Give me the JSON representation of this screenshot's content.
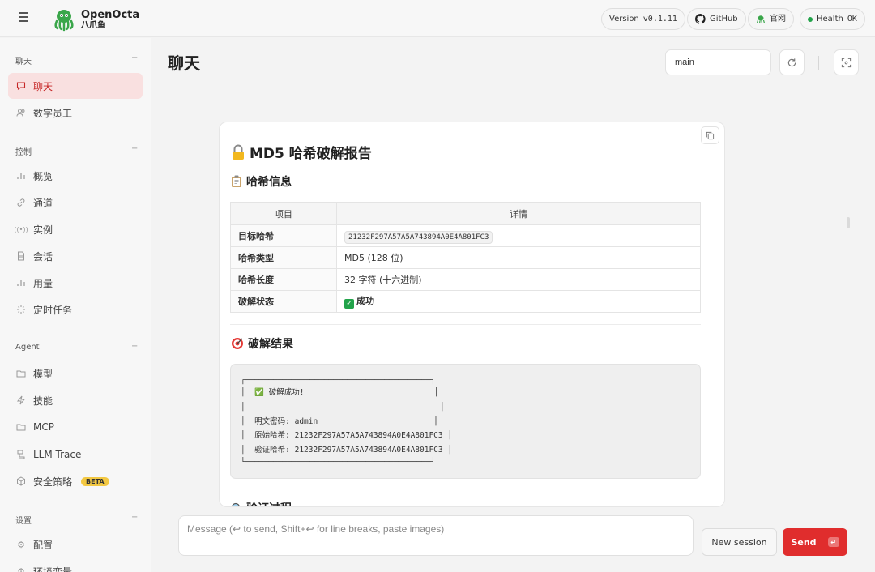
{
  "header": {
    "brand_name": "OpenOcta",
    "brand_sub": "八爪鱼",
    "version_label": "Version",
    "version_value": "v0.1.11",
    "github_label": "GitHub",
    "website_label": "官网",
    "health_label": "Health",
    "health_value": "OK"
  },
  "sidebar": {
    "groups": [
      {
        "title": "聊天",
        "collapse": "−"
      },
      {
        "title": "控制",
        "collapse": "−"
      },
      {
        "title": "Agent",
        "collapse": "−"
      },
      {
        "title": "设置",
        "collapse": "−"
      }
    ],
    "items": [
      {
        "label": "聊天",
        "icon": "chat-bubble-icon",
        "active": true
      },
      {
        "label": "数字员工",
        "icon": "users-icon"
      },
      {
        "label": "概览",
        "icon": "bar-chart-icon"
      },
      {
        "label": "通道",
        "icon": "link-icon"
      },
      {
        "label": "实例",
        "icon": "radio-waves-icon"
      },
      {
        "label": "会话",
        "icon": "document-icon"
      },
      {
        "label": "用量",
        "icon": "bar-chart-icon"
      },
      {
        "label": "定时任务",
        "icon": "loader-icon"
      },
      {
        "label": "模型",
        "icon": "folder-icon"
      },
      {
        "label": "技能",
        "icon": "lightning-icon"
      },
      {
        "label": "MCP",
        "icon": "folder-icon"
      },
      {
        "label": "LLM Trace",
        "icon": "trace-icon"
      },
      {
        "label": "安全策略",
        "icon": "cube-icon",
        "badge": "BETA"
      },
      {
        "label": "配置",
        "icon": "gear-icon"
      },
      {
        "label": "环境变量",
        "icon": "variable-icon"
      }
    ]
  },
  "main": {
    "title": "聊天",
    "session_value": "main"
  },
  "report": {
    "title": "MD5 哈希破解报告",
    "info_heading": "哈希信息",
    "table_headers": [
      "项目",
      "详情"
    ],
    "rows": [
      {
        "key": "目标哈希",
        "value": "21232F297A57A5A743894A0E4A801FC3"
      },
      {
        "key": "哈希类型",
        "value": "MD5 (128 位)"
      },
      {
        "key": "哈希长度",
        "value": "32 字符 (十六进制)"
      },
      {
        "key": "破解状态",
        "value": "成功"
      }
    ],
    "result_heading": "破解结果",
    "code_lines": [
      "┌────────────────────────────────────────┐",
      "│  ✅ 破解成功!                            │",
      "│                                          │",
      "│  明文密码: admin                         │",
      "│  原始哈希: 21232F297A57A5A743894A0E4A801FC3 │",
      "│  验证哈希: 21232F297A57A5A743894A0E4A801FC3 │",
      "└────────────────────────────────────────┘"
    ],
    "next_heading": "验证过程"
  },
  "composer": {
    "placeholder": "Message (↩ to send, Shift+↩ for line breaks, paste images)",
    "new_session_label": "New session",
    "send_label": "Send",
    "send_key": "↵"
  }
}
